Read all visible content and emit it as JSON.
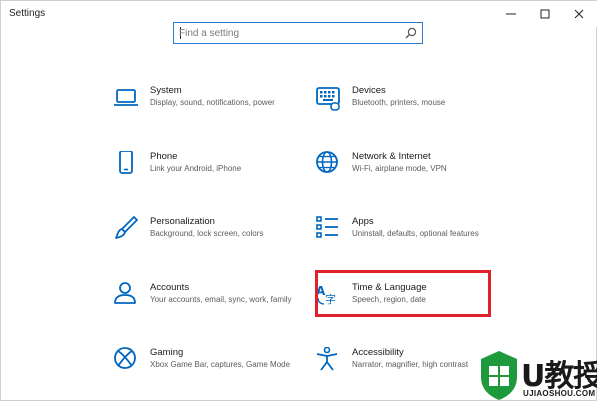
{
  "window": {
    "title": "Settings",
    "controls": {
      "minimize_icon": "minimize-icon",
      "maximize_icon": "maximize-icon",
      "close_icon": "close-icon"
    }
  },
  "search": {
    "placeholder": "Find a setting",
    "icon": "search-icon"
  },
  "categories": [
    {
      "title": "System",
      "description": "Display, sound, notifications, power",
      "icon": "laptop-icon"
    },
    {
      "title": "Devices",
      "description": "Bluetooth, printers, mouse",
      "icon": "keyboard-icon"
    },
    {
      "title": "Phone",
      "description": "Link your Android, iPhone",
      "icon": "phone-icon"
    },
    {
      "title": "Network & Internet",
      "description": "Wi-Fi, airplane mode, VPN",
      "icon": "globe-icon"
    },
    {
      "title": "Personalization",
      "description": "Background, lock screen, colors",
      "icon": "paintbrush-icon"
    },
    {
      "title": "Apps",
      "description": "Uninstall, defaults, optional features",
      "icon": "apps-list-icon"
    },
    {
      "title": "Accounts",
      "description": "Your accounts, email, sync, work, family",
      "icon": "person-icon"
    },
    {
      "title": "Time & Language",
      "description": "Speech, region, date",
      "icon": "time-language-icon",
      "highlighted": true
    },
    {
      "title": "Gaming",
      "description": "Xbox Game Bar, captures, Game Mode",
      "icon": "xbox-icon"
    },
    {
      "title": "Accessibility",
      "description": "Narrator, magnifier, high contrast",
      "icon": "accessibility-icon"
    }
  ],
  "colors": {
    "accent": "#0067c0",
    "highlight": "#e0202a",
    "watermark_green": "#1e9a3c"
  },
  "watermark": {
    "text": "U教授",
    "subtext": "UJIAOSHOU.COM"
  }
}
